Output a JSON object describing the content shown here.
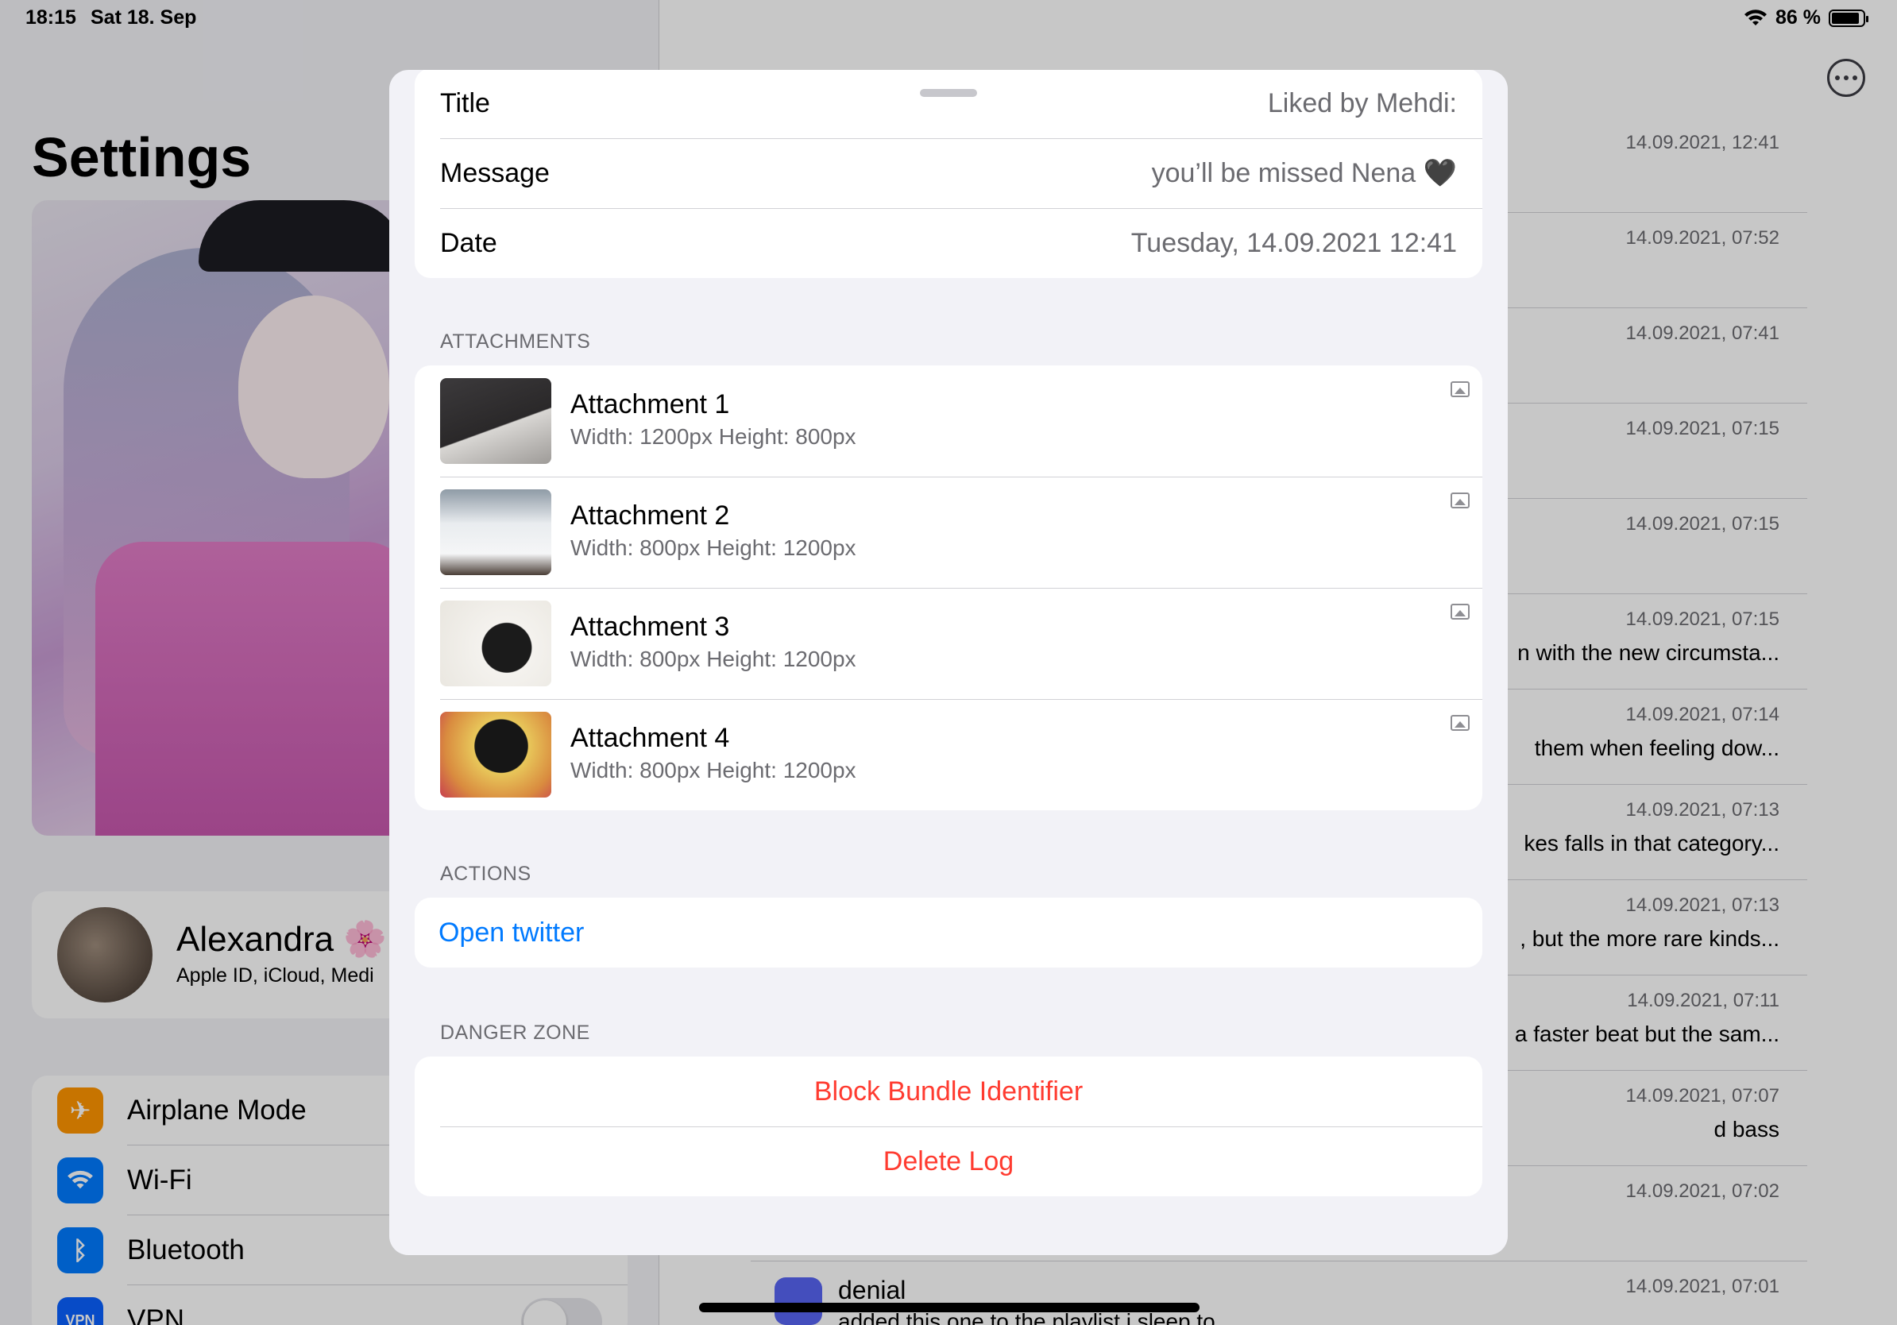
{
  "status": {
    "time": "18:15",
    "date": "Sat 18. Sep",
    "battery": "86 %"
  },
  "settings": {
    "title": "Settings",
    "profile_name": "Alexandra 🌸",
    "profile_sub": "Apple ID, iCloud, Medi",
    "items": [
      {
        "label": "Airplane Mode",
        "icon": "airplane-icon",
        "color": "#ff9500"
      },
      {
        "label": "Wi-Fi",
        "icon": "wifi-icon",
        "color": "#007aff"
      },
      {
        "label": "Bluetooth",
        "icon": "bluetooth-icon",
        "color": "#007aff"
      },
      {
        "label": "VPN",
        "icon": "vpn-icon",
        "color": "#0a60ff"
      }
    ]
  },
  "log_list": [
    {
      "date": "14.09.2021, 12:41",
      "snippet": ""
    },
    {
      "date": "14.09.2021, 07:52",
      "snippet": ""
    },
    {
      "date": "14.09.2021, 07:41",
      "snippet": ""
    },
    {
      "date": "14.09.2021, 07:15",
      "snippet": ""
    },
    {
      "date": "14.09.2021, 07:15",
      "snippet": ""
    },
    {
      "date": "14.09.2021, 07:15",
      "snippet": "n with the new circumsta..."
    },
    {
      "date": "14.09.2021, 07:14",
      "snippet": "them when feeling dow..."
    },
    {
      "date": "14.09.2021, 07:13",
      "snippet": "kes falls in that category..."
    },
    {
      "date": "14.09.2021, 07:13",
      "snippet": ", but the more rare kinds..."
    },
    {
      "date": "14.09.2021, 07:11",
      "snippet": "a faster beat but the sam..."
    },
    {
      "date": "14.09.2021, 07:07",
      "snippet": "d bass"
    },
    {
      "date": "14.09.2021, 07:02",
      "snippet": ""
    }
  ],
  "last_log": {
    "app": "denial",
    "text": "added this one to the playlist i sleep to",
    "date": "14.09.2021, 07:01"
  },
  "sheet": {
    "details": [
      {
        "key": "Title",
        "value": "Liked by Mehdi:"
      },
      {
        "key": "Message",
        "value": "you’ll be missed Nena 🖤"
      },
      {
        "key": "Date",
        "value": "Tuesday, 14.09.2021 12:41"
      }
    ],
    "attachments_header": "ATTACHMENTS",
    "attachments": [
      {
        "title": "Attachment 1",
        "size": "Width: 1200px Height: 800px"
      },
      {
        "title": "Attachment 2",
        "size": "Width: 800px Height: 1200px"
      },
      {
        "title": "Attachment 3",
        "size": "Width: 800px Height: 1200px"
      },
      {
        "title": "Attachment 4",
        "size": "Width: 800px Height: 1200px"
      }
    ],
    "actions_header": "ACTIONS",
    "open_twitter": "Open twitter",
    "danger_header": "DANGER ZONE",
    "block_bundle": "Block Bundle Identifier",
    "delete_log": "Delete Log"
  }
}
